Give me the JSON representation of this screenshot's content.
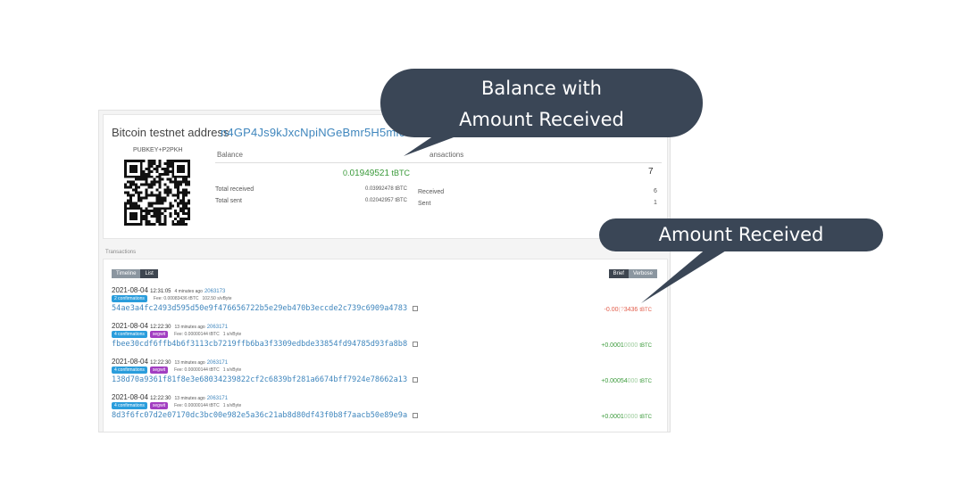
{
  "address": {
    "title": "Bitcoin testnet address",
    "value": "n4GP4Js9kJxcNpiNGeBmr5H5mi69PP1y",
    "type": "PUBKEY+P2PKH"
  },
  "balance": {
    "heading": "Balance",
    "amount_lead": "0.",
    "amount_rest": "01949521",
    "unit": "tBTC",
    "total_received_label": "Total received",
    "total_received_value": "0.03992478 tBTC",
    "total_sent_label": "Total sent",
    "total_sent_value": "0.02042957 tBTC"
  },
  "transactions_summary": {
    "heading": "ansactions",
    "count": "7",
    "received_label": "Received",
    "received_value": "6",
    "sent_label": "Sent",
    "sent_value": "1"
  },
  "tx_section": {
    "label": "Transactions",
    "view_tabs": [
      "Timeline",
      "List"
    ],
    "detail_tabs": [
      "Brief",
      "Verbose"
    ]
  },
  "transactions": [
    {
      "date": "2021-08-04",
      "time": "12:31:05",
      "ago": "4 minutes ago",
      "block": "2063173",
      "confirmations": "2 confirmations",
      "segwit": "",
      "fee_label": "Fee:",
      "fee": "0.00083436 tBTC",
      "vsize": "102.50 s/vByte",
      "txid": "54ae3a4fc2493d595d50e9f476656722b5e29eb470b3eccde2c739c6909a4783",
      "amount_main": "-0.00",
      "amount_dim": "(?",
      "amount_tail": "3436",
      "unit": "tBTC",
      "direction": "neg"
    },
    {
      "date": "2021-08-04",
      "time": "12:22:30",
      "ago": "13 minutes ago",
      "block": "2063171",
      "confirmations": "4 confirmations",
      "segwit": "segwit",
      "fee_label": "Fee:",
      "fee": "0.00000144 tBTC",
      "vsize": "1 s/vByte",
      "txid": "fbee30cdf6ffb4b6f3113cb7219ffb6ba3f3309edbde33854fd94785d93fa8b8",
      "amount_main": "+0.0001",
      "amount_dim": "0000",
      "amount_tail": "",
      "unit": "tBTC",
      "direction": "pos"
    },
    {
      "date": "2021-08-04",
      "time": "12:22:30",
      "ago": "13 minutes ago",
      "block": "2063171",
      "confirmations": "4 confirmations",
      "segwit": "segwit",
      "fee_label": "Fee:",
      "fee": "0.00000144 tBTC",
      "vsize": "1 s/vByte",
      "txid": "138d70a9361f81f8e3e68034239822cf2c6839bf281a6674bff7924e78662a13",
      "amount_main": "+0.00054",
      "amount_dim": "000",
      "amount_tail": "",
      "unit": "tBTC",
      "direction": "pos"
    },
    {
      "date": "2021-08-04",
      "time": "12:22:30",
      "ago": "13 minutes ago",
      "block": "2063171",
      "confirmations": "4 confirmations",
      "segwit": "segwit",
      "fee_label": "Fee:",
      "fee": "0.00000144 tBTC",
      "vsize": "1 s/vByte",
      "txid": "8d3f6fc07d2e07170dc3bc00e982e5a36c21ab8d80df43f0b8f7aacb50e89e9a",
      "amount_main": "+0.0001",
      "amount_dim": "0000",
      "amount_tail": "",
      "unit": "tBTC",
      "direction": "pos"
    }
  ],
  "callouts": {
    "balance_line1": "Balance with",
    "balance_line2": "Amount Received",
    "amount": "Amount Received"
  },
  "colors": {
    "callout_bg": "#3a4656",
    "link": "#3f86bd",
    "positive": "#3a9a3a",
    "negative": "#e25c4a"
  }
}
